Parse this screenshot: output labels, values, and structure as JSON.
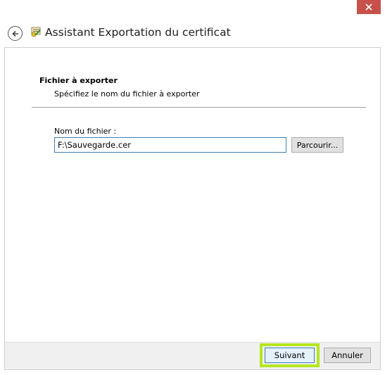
{
  "window": {
    "title": "Assistant Exportation du certificat",
    "close_icon": "close-icon",
    "back_icon": "back-arrow-icon",
    "wizard_icon": "certificate-wizard-icon"
  },
  "page": {
    "heading": "Fichier à exporter",
    "subtitle": "Spécifiez le nom du fichier à exporter"
  },
  "file": {
    "label": "Nom du fichier :",
    "value": "F:\\Sauvegarde.cer",
    "browse_label": "Parcourir..."
  },
  "footer": {
    "next_label": "Suivant",
    "cancel_label": "Annuler",
    "highlight_color": "#b5e61d"
  },
  "colors": {
    "close_button": "#c7514a",
    "focus_border": "#3c7fb1"
  }
}
